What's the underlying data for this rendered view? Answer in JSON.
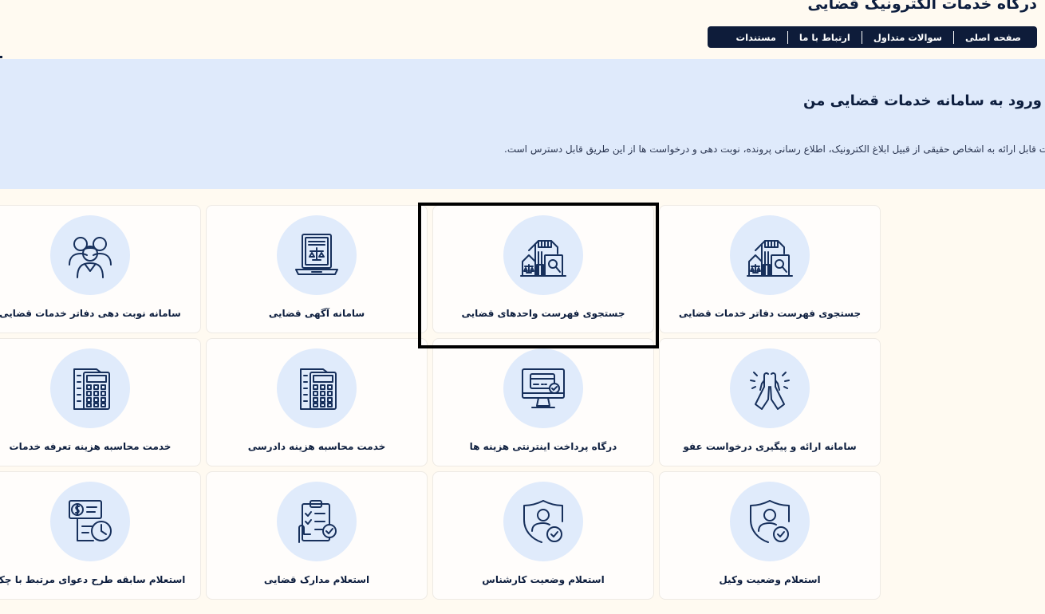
{
  "header": {
    "site_title": "درگاه خدمات الکترونیک قضایی",
    "nav": [
      {
        "label": "صفحه اصلی"
      },
      {
        "label": "سوالات متداول"
      },
      {
        "label": "ارتباط با ما"
      },
      {
        "label": "مستندات"
      }
    ]
  },
  "hero": {
    "title": "ورود به سامانه خدمات قضایی من",
    "description": "ت قابل ارائه به اشخاص حقیقی از قبیل ابلاغ الکترونیک، اطلاع رسانی پرونده، نوبت دهی و درخواست ها از این طریق قابل دسترس است."
  },
  "colors": {
    "page_bg": "#fffaf1",
    "hero_bg": "#dfeafb",
    "nav_bg": "#0e1c3a",
    "icon_circle": "#e0ebfb",
    "icon_stroke": "#17305c"
  },
  "cards": [
    {
      "label": "جستجوی فهرست دفاتر خدمات قضایی",
      "icon": "building-search-icon"
    },
    {
      "label": "جستجوی فهرست واحدهای قضایی",
      "icon": "building-search-icon"
    },
    {
      "label": "سامانه آگهی قضایی",
      "icon": "laptop-scales-icon"
    },
    {
      "label": "سامانه نوبت دهی دفاتر خدمات قضایی",
      "icon": "people-group-icon"
    },
    {
      "label": "سامانه ارائه و پیگیری درخواست عفو",
      "icon": "praying-hands-icon"
    },
    {
      "label": "درگاه پرداخت اینترنتی هزینه ها",
      "icon": "monitor-card-icon"
    },
    {
      "label": "خدمت محاسبه هزینه دادرسی",
      "icon": "calculator-icon"
    },
    {
      "label": "خدمت محاسبه هزینه تعرفه خدمات",
      "icon": "calculator-icon"
    },
    {
      "label": "استعلام وضعیت وکیل",
      "icon": "shield-user-check-icon"
    },
    {
      "label": "استعلام وضعیت کارشناس",
      "icon": "shield-user-check-icon"
    },
    {
      "label": "استعلام مدارک قضایی",
      "icon": "clipboard-check-icon"
    },
    {
      "label": "استعلام سابقه طرح دعوای مرتبط با چک",
      "icon": "cheque-clock-icon"
    }
  ]
}
